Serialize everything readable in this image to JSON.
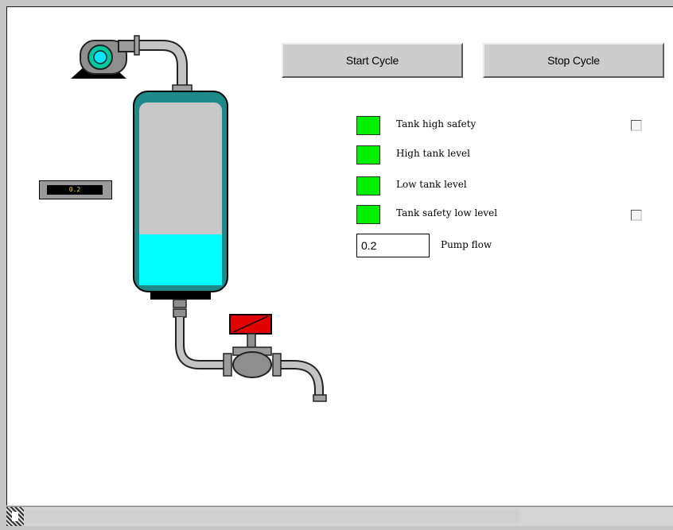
{
  "buttons": {
    "start": "Start Cycle",
    "stop": "Stop Cycle"
  },
  "indicators": [
    {
      "label": "Tank high safety",
      "state": "on",
      "has_checkbox": true,
      "checked": false
    },
    {
      "label": "High tank level",
      "state": "on",
      "has_checkbox": false
    },
    {
      "label": "Low tank level",
      "state": "on",
      "has_checkbox": false
    },
    {
      "label": "Tank safety low level",
      "state": "on",
      "has_checkbox": true,
      "checked": false
    }
  ],
  "pump_flow": {
    "value": "0.2",
    "label": "Pump flow"
  },
  "meter": {
    "value": "0.2"
  },
  "tank": {
    "fill_level": 0.28
  },
  "colors": {
    "indicator_on": "#00f000",
    "liquid": "#00ffff",
    "tank_body": "#c8c8c8",
    "tank_outline": "#1e8a8a",
    "valve_actuator": "#e00000"
  },
  "icons": {
    "pump": "centrifugal-pump-icon",
    "valve": "control-valve-icon",
    "tank": "vertical-tank-icon"
  }
}
